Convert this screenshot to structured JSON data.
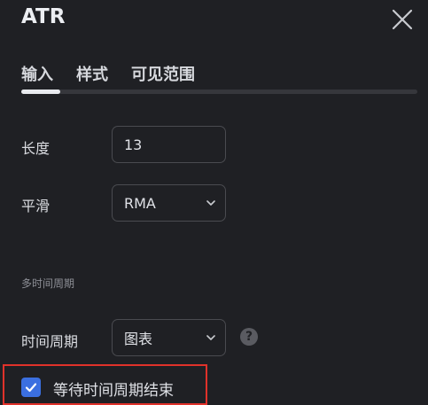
{
  "dialog": {
    "title": "ATR"
  },
  "tabs": [
    {
      "label": "输入",
      "active": true
    },
    {
      "label": "样式",
      "active": false
    },
    {
      "label": "可见范围",
      "active": false
    }
  ],
  "inputs": {
    "length": {
      "label": "长度",
      "value": "13"
    },
    "smoothing": {
      "label": "平滑",
      "value": "RMA"
    }
  },
  "multi_timeframe": {
    "section_title": "多时间周期",
    "timeframe": {
      "label": "时间周期",
      "value": "图表"
    },
    "help_icon": "?",
    "wait_for_close": {
      "label": "等待时间周期结束",
      "checked": true
    }
  },
  "colors": {
    "background": "#1f2024",
    "accent": "#3b6fe0",
    "highlight": "#e0322a"
  }
}
